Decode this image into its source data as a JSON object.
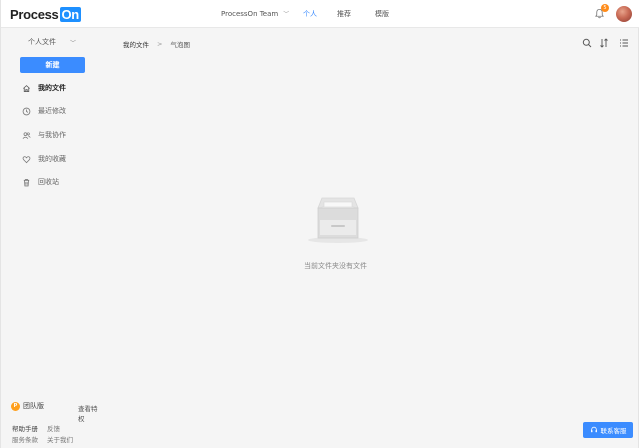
{
  "header": {
    "logo_text": "Process",
    "logo_badge": "On",
    "team_name": "ProcessOn Team",
    "tabs": [
      {
        "label": "个人",
        "active": true
      },
      {
        "label": "推荐",
        "active": false
      },
      {
        "label": "模版",
        "active": false
      }
    ],
    "notification_count": "5",
    "accent_color": "#3b8cff"
  },
  "sidebar": {
    "space_selector": "个人文件",
    "new_button": "新建",
    "items": [
      {
        "label": "我的文件",
        "icon": "home-icon",
        "active": true
      },
      {
        "label": "最近修改",
        "icon": "clock-icon",
        "active": false
      },
      {
        "label": "与我协作",
        "icon": "people-icon",
        "active": false
      },
      {
        "label": "我的收藏",
        "icon": "heart-icon",
        "active": false
      },
      {
        "label": "回收站",
        "icon": "trash-icon",
        "active": false
      }
    ],
    "team_version": "团队版",
    "view_rights": "查看特权",
    "footer_links": [
      "帮助手册",
      "反馈",
      "服务条款",
      "关于我们"
    ]
  },
  "main": {
    "breadcrumb": [
      "我的文件",
      "气泡图"
    ],
    "breadcrumb_sep": ">",
    "empty_message": "当前文件夹没有文件"
  },
  "contact_button": "联系客服"
}
